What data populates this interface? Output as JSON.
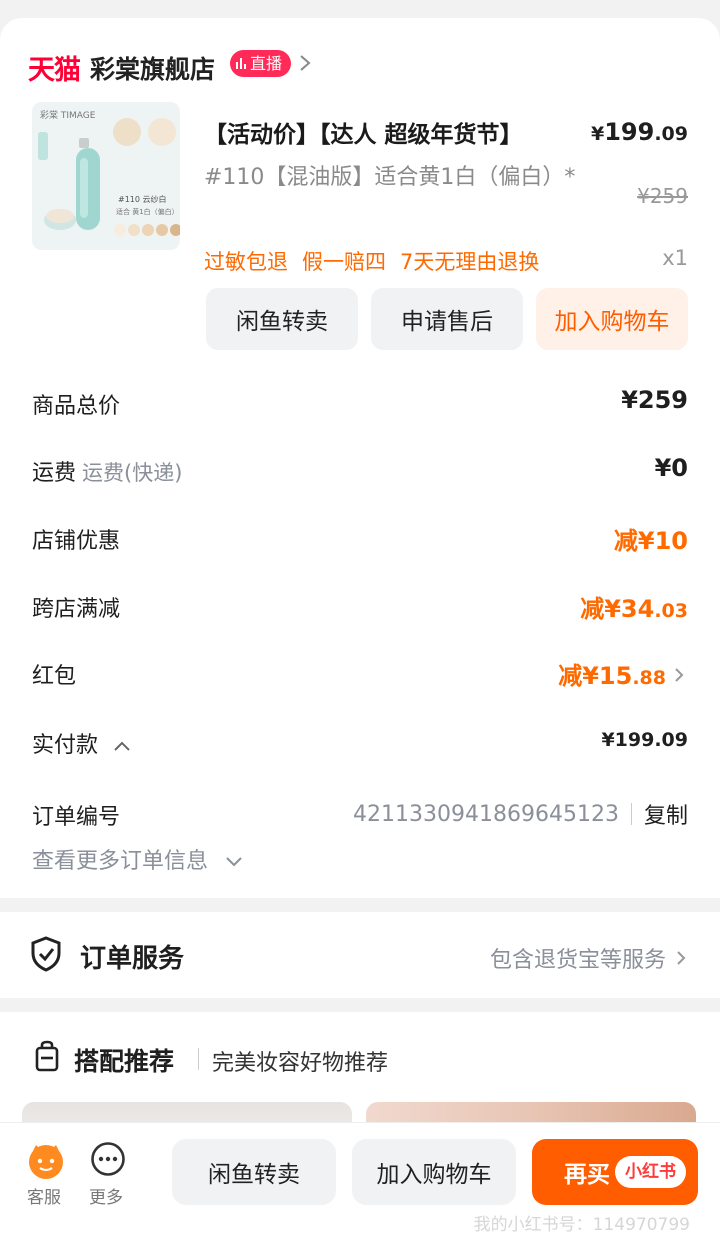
{
  "store": {
    "platform_logo": "天猫",
    "name": "彩棠旗舰店",
    "live_label": "直播"
  },
  "product": {
    "title": "【活动价】【达人 超级年货节】",
    "price_main": "199",
    "price_decimal": ".09",
    "currency": "¥",
    "variant": "#110【混油版】适合黄1白（偏白）*",
    "original_price": "¥259",
    "image_brand": "彩棠 TIMAGE",
    "image_caption": "#110 云纱白",
    "image_caption2": "适合 黄1白（偏白）",
    "tags": [
      "过敏包退",
      "假一赔四",
      "7天无理由退换"
    ],
    "quantity": "x1"
  },
  "actions": {
    "xianyu": "闲鱼转卖",
    "after_sales": "申请售后",
    "add_cart": "加入购物车"
  },
  "summary": {
    "goods_total_label": "商品总价",
    "goods_total_value": "¥259",
    "shipping_label": "运费",
    "shipping_sub": "运费(快递)",
    "shipping_value": "¥0",
    "store_discount_label": "店铺优惠",
    "store_discount_prefix": "减",
    "store_discount_value": "¥10",
    "cross_label": "跨店满减",
    "cross_prefix": "减",
    "cross_int": "¥34",
    "cross_dec": ".03",
    "redpack_label": "红包",
    "redpack_prefix": "减",
    "redpack_int": "¥15",
    "redpack_dec": ".88",
    "paid_label": "实付款",
    "paid_int": "¥199",
    "paid_dec": ".09",
    "order_no_label": "订单编号",
    "order_no": "4211330941869645123",
    "copy": "复制",
    "more_info": "查看更多订单信息"
  },
  "service": {
    "title": "订单服务",
    "detail": "包含退货宝等服务"
  },
  "recommend": {
    "title": "搭配推荐",
    "subtitle": "完美妆容好物推荐"
  },
  "bottom": {
    "service_label": "客服",
    "more_label": "更多",
    "xianyu": "闲鱼转卖",
    "add_cart": "加入购物车",
    "buy_again": "再买",
    "xhs_badge": "小红书",
    "watermark": "我的小红书号：114970799"
  },
  "colors": {
    "accent": "#ff5d00",
    "tmall_red": "#ff0036",
    "discount": "#ff6a00"
  }
}
